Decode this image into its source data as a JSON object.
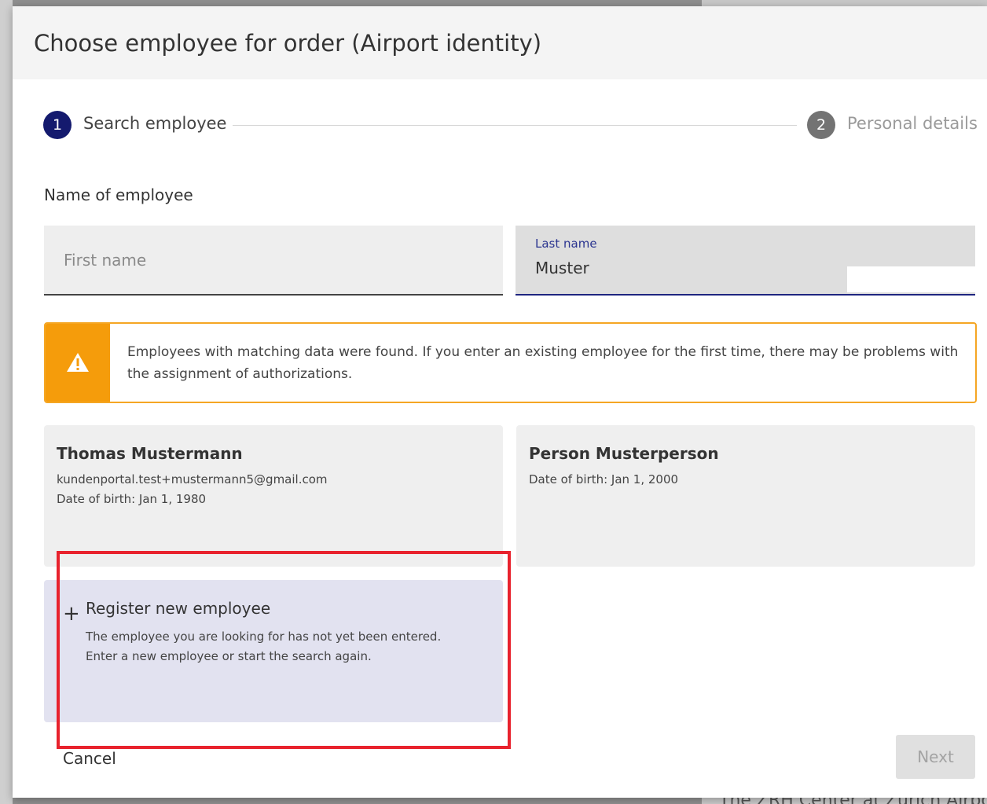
{
  "background": {
    "footer_text": "The ZRH Center at Zurich Airport"
  },
  "dialog": {
    "title": "Choose employee for order (Airport identity)"
  },
  "stepper": {
    "steps": [
      {
        "number": "1",
        "label": "Search employee",
        "state": "active"
      },
      {
        "number": "2",
        "label": "Personal details",
        "state": "inactive"
      }
    ]
  },
  "form": {
    "section_label": "Name of employee",
    "first_name": {
      "placeholder": "First name",
      "value": ""
    },
    "last_name": {
      "label": "Last name",
      "value": "Muster"
    }
  },
  "warning": {
    "icon": "warning-triangle-icon",
    "text": "Employees with matching data were found. If you enter an existing employee for the first time, there may be problems with the assignment of authorizations."
  },
  "results": [
    {
      "name": "Thomas Mustermann",
      "email": "kundenportal.test+mustermann5@gmail.com",
      "dob": "Date of birth: Jan 1, 1980"
    },
    {
      "name": "Person Musterperson",
      "dob": "Date of birth: Jan 1, 2000"
    }
  ],
  "new_employee": {
    "icon": "plus-icon",
    "title": "Register new employee",
    "desc_line1": "The employee you are looking for has not yet been entered.",
    "desc_line2": "Enter a new employee or start the search again."
  },
  "actions": {
    "cancel": "Cancel",
    "next": "Next"
  },
  "colors": {
    "primary": "#141a6e",
    "warning": "#f59c0b",
    "highlight": "#e8222d",
    "new_card_bg": "#e2e2f0"
  }
}
